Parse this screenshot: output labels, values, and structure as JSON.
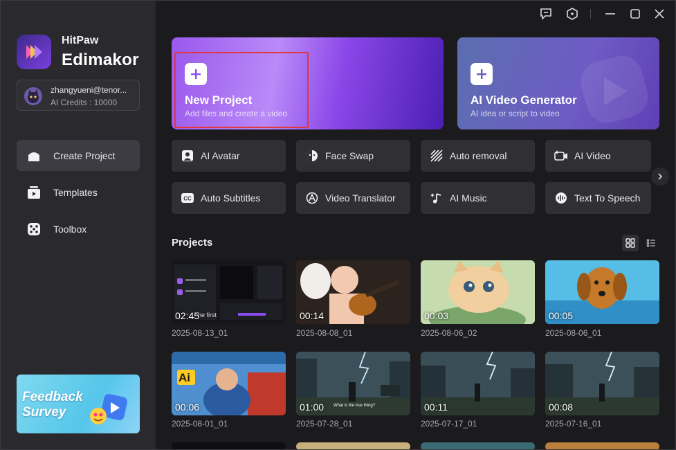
{
  "app": {
    "brand_top": "HitPaw",
    "brand_main": "Edimakor"
  },
  "account": {
    "email": "zhangyueni@tenor...",
    "credits": "AI Credits : 10000"
  },
  "nav": [
    {
      "label": "Create Project",
      "icon": "home-icon",
      "active": true
    },
    {
      "label": "Templates",
      "icon": "templates-icon",
      "active": false
    },
    {
      "label": "Toolbox",
      "icon": "toolbox-icon",
      "active": false
    }
  ],
  "feedback": {
    "line1": "Feedback",
    "line2": "Survey"
  },
  "hero": {
    "new_project": {
      "title": "New Project",
      "subtitle": "Add files and create a video"
    },
    "ai_video": {
      "title": "AI Video Generator",
      "subtitle": "AI idea or script to video"
    }
  },
  "tools": [
    {
      "label": "AI Avatar",
      "icon": "avatar-icon"
    },
    {
      "label": "Face Swap",
      "icon": "face-swap-icon"
    },
    {
      "label": "Auto removal",
      "icon": "auto-removal-icon"
    },
    {
      "label": "AI Video",
      "icon": "ai-video-icon"
    },
    {
      "label": "Auto Subtitles",
      "icon": "cc-icon"
    },
    {
      "label": "Video Translator",
      "icon": "translate-icon"
    },
    {
      "label": "AI Music",
      "icon": "music-icon"
    },
    {
      "label": "Text To Speech",
      "icon": "speech-icon"
    }
  ],
  "projects": {
    "title": "Projects",
    "items": [
      {
        "name": "2025-08-13_01",
        "duration": "02:45"
      },
      {
        "name": "2025-08-08_01",
        "duration": "00:14"
      },
      {
        "name": "2025-08-06_02",
        "duration": "00:03"
      },
      {
        "name": "2025-08-06_01",
        "duration": "00:05"
      },
      {
        "name": "2025-08-01_01",
        "duration": "00:06"
      },
      {
        "name": "2025-07-28_01",
        "duration": "01:00"
      },
      {
        "name": "2025-07-17_01",
        "duration": "00:11"
      },
      {
        "name": "2025-07-16_01",
        "duration": "00:08"
      }
    ],
    "thumb_captions": {
      "t0": "he first",
      "t4": "Ai",
      "t5": "What is the true thing?"
    }
  },
  "colors": {
    "accent": "#8b4df0",
    "highlight": "#e0383e",
    "sidebar": "#2a2a2e",
    "background": "#1b1b1e"
  }
}
